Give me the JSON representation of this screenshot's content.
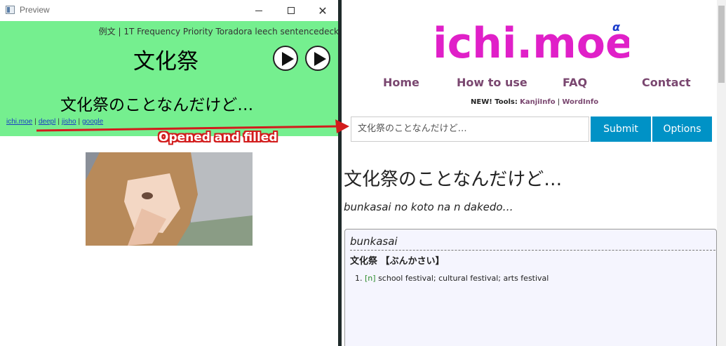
{
  "preview_window": {
    "title": "Preview",
    "deck_info": "例文 | 1T Frequency Priority Toradora leech sentencedeck",
    "word": "文化祭",
    "sentence": "文化祭のことなんだけど…",
    "links": [
      "ichi.moe",
      "deepl",
      "jisho",
      "google"
    ],
    "link_separator": "|",
    "colors": {
      "card_bg": "#75ef8f",
      "link": "#1b3ec4"
    }
  },
  "browser": {
    "logo": {
      "text": "ichi.moe",
      "superscript": "α",
      "color": "#e020c8"
    },
    "nav": [
      "Home",
      "How to use",
      "FAQ",
      "Contact"
    ],
    "tools": {
      "prefix": "NEW! Tools:",
      "items": [
        "KanjiInfo",
        "WordInfo"
      ],
      "separator": "|"
    },
    "search": {
      "value": "文化祭のことなんだけど…"
    },
    "buttons": {
      "submit": "Submit",
      "options": "Options"
    },
    "result": {
      "title": "文化祭のことなんだけど…",
      "romaji": "bunkasai no koto na n dakedo…",
      "entry": {
        "romaji": "bunkasai",
        "headword": "文化祭 【ぶんかさい】",
        "definitions": [
          {
            "num": "1.",
            "pos": "[n]",
            "gloss": "school festival; cultural festival; arts festival"
          }
        ]
      }
    },
    "colors": {
      "accent": "#0092c6",
      "nav": "#7a4770",
      "entry_bg": "#f5f5fe"
    }
  },
  "annotation": {
    "label": "Opened and filled",
    "color": "#d21c1c"
  }
}
